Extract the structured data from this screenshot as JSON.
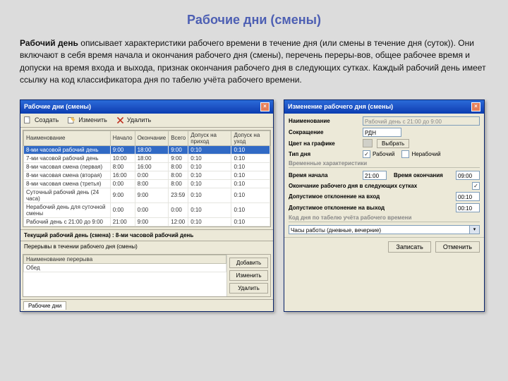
{
  "page": {
    "title": "Рабочие дни (смены)",
    "bold_term": "Рабочий день",
    "description": " описывает характеристики рабочего времени в течение дня (или смены в течение дня (суток)). Они включают в себя время начала и окончания рабочего дня (смены), перечень переры-вов, общее рабочее время и допуски на время входа и выхода, признак окончания рабочего дня в следующих сутках. Каждый рабочий день имеет ссылку на код классификатора дня по табелю учёта рабочего времени."
  },
  "win1": {
    "title": "Рабочие дни (смены)",
    "toolbar": {
      "create": "Создать",
      "edit": "Изменить",
      "del": "Удалить"
    },
    "columns": [
      "Наименование",
      "Начало",
      "Окончание",
      "Всего",
      "Допуск на приход",
      "Допуск на уход"
    ],
    "rows": [
      [
        "8-ми часовой рабочий день",
        "9:00",
        "18:00",
        "9:00",
        "0:10",
        "0:10"
      ],
      [
        "7-ми часовой рабочий день",
        "10:00",
        "18:00",
        "9:00",
        "0:10",
        "0:10"
      ],
      [
        "8-ми часовая смена (первая)",
        "8:00",
        "16:00",
        "8:00",
        "0:10",
        "0:10"
      ],
      [
        "8-ми часовая смена (вторая)",
        "16:00",
        "0:00",
        "8:00",
        "0:10",
        "0:10"
      ],
      [
        "8-ми часовая смена (третья)",
        "0:00",
        "8:00",
        "8:00",
        "0:10",
        "0:10"
      ],
      [
        "Суточный рабочий день (24 часа)",
        "9:00",
        "9:00",
        "23:59",
        "0:10",
        "0:10"
      ],
      [
        "Нерабочий день для суточной смены",
        "0:00",
        "0:00",
        "0:00",
        "0:10",
        "0:10"
      ],
      [
        "Рабочий день с 21:00 до 9:00",
        "21:00",
        "9:00",
        "12:00",
        "0:10",
        "0:10"
      ]
    ],
    "current_label": "Текущий рабочий день (смена) : 8-ми часовой рабочий день",
    "breaks_label": "Перерывы в течении рабочего дня (смены)",
    "breaks_columns": [
      "Наименование перерыва"
    ],
    "breaks_rows": [
      "Обед"
    ],
    "break_btns": {
      "add": "Добавить",
      "edit": "Изменить",
      "del": "Удалить"
    },
    "tab": "Рабочие дни"
  },
  "win2": {
    "title": "Изменение рабочего дня (смены)",
    "fields": {
      "name": {
        "label": "Наименование",
        "value": "Рабочий день с 21:00 до 9:00"
      },
      "short": {
        "label": "Сокращение",
        "value": "РДН"
      },
      "color": {
        "label": "Цвет на графике",
        "btn": "Выбрать"
      },
      "daytype": {
        "label": "Тип дня",
        "opt1": "Рабочий",
        "opt2": "Нерабочий"
      },
      "start": {
        "label": "Время начала",
        "value": "21:00"
      },
      "end": {
        "label": "Время окончания",
        "value": "09:00"
      },
      "nextday": {
        "label": "Окончание рабочего дня в следующих сутках"
      },
      "tol_in": {
        "label": "Допустимое отклонение на вход",
        "value": "00:10"
      },
      "tol_out": {
        "label": "Допустимое отклонение на выход",
        "value": "00:10"
      },
      "code": {
        "value": "Часы работы (дневные, вечерние)"
      }
    },
    "section_time": "Временные характеристики",
    "section_code": "Код дня по табелю учёта рабочего времени",
    "buttons": {
      "save": "Записать",
      "cancel": "Отменить"
    }
  }
}
